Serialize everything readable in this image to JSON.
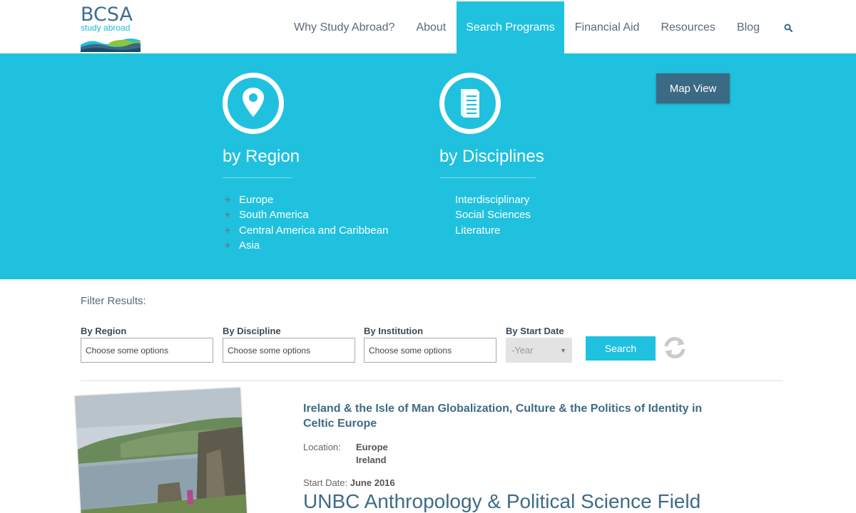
{
  "logo": {
    "name": "BCSA",
    "tagline": "study abroad"
  },
  "nav": {
    "items": [
      "Why Study Abroad?",
      "About",
      "Search Programs",
      "Financial Aid",
      "Resources",
      "Blog"
    ],
    "active": "Search Programs"
  },
  "banner": {
    "map_view": "Map View",
    "region": {
      "title": "by Region",
      "items": [
        "Europe",
        "South America",
        "Central America and Caribbean",
        "Asia"
      ]
    },
    "disciplines": {
      "title": "by Disciplines",
      "items": [
        "Interdisciplinary",
        "Social Sciences",
        "Literature"
      ]
    }
  },
  "filter": {
    "heading": "Filter Results:",
    "region_label": "By Region",
    "discipline_label": "By Discipline",
    "institution_label": "By Institution",
    "start_date_label": "By Start Date",
    "placeholder": "Choose some options",
    "year": "-Year",
    "search": "Search"
  },
  "results": [
    {
      "title": "Ireland & the Isle of Man Globalization, Culture & the Politics of Identity in Celtic Europe",
      "location_label": "Location:",
      "locations": [
        "Europe",
        "Ireland"
      ],
      "start_label": "Start Date:",
      "start": "June 2016"
    },
    {
      "title": "UNBC Anthropology & Political Science Field"
    }
  ],
  "colors": {
    "accent": "#1fc1df",
    "dark": "#3b6a84",
    "title": "#3f6b85"
  }
}
